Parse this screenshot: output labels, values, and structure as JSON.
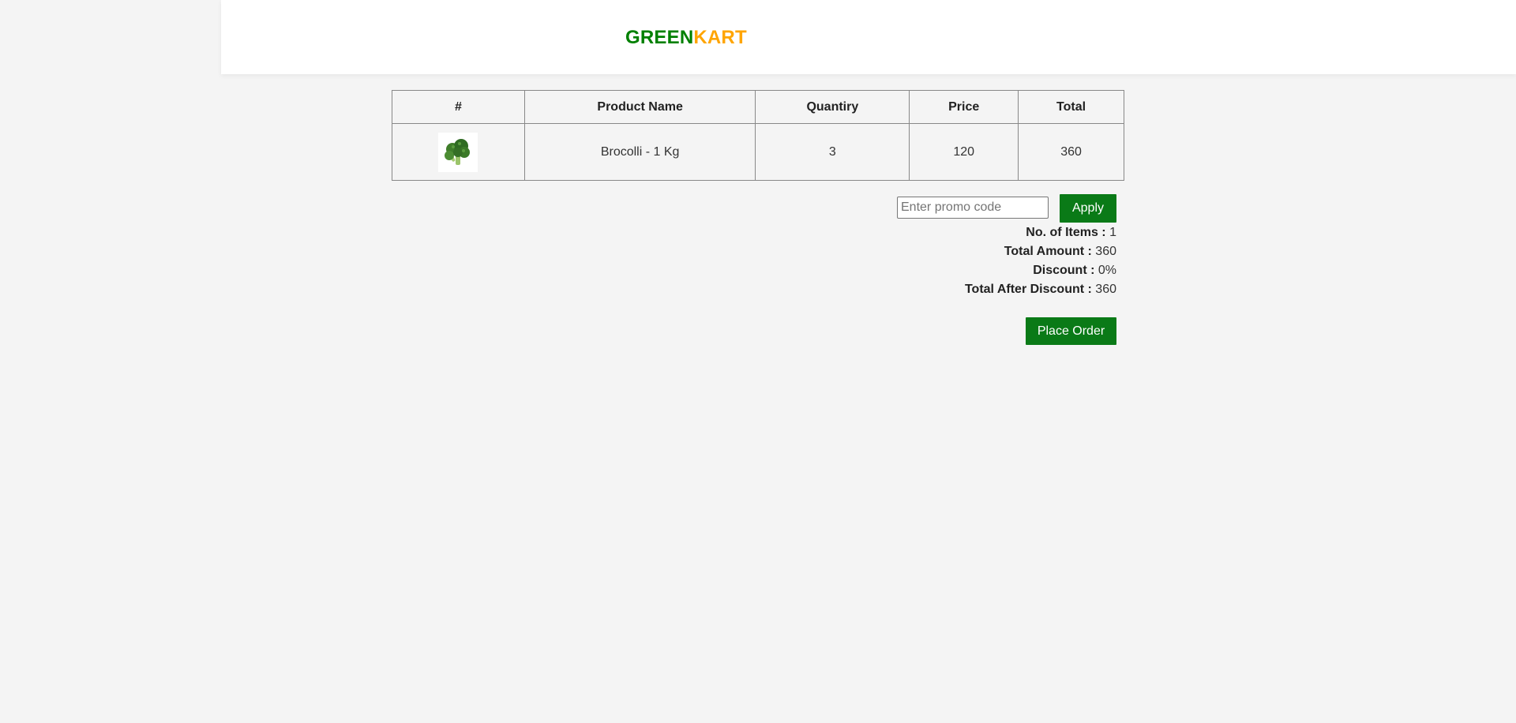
{
  "header": {
    "logo_part1": "GREEN",
    "logo_part2": "KART"
  },
  "table": {
    "columns": [
      "#",
      "Product Name",
      "Quantiry",
      "Price",
      "Total"
    ],
    "rows": [
      {
        "image_icon": "broccoli-icon",
        "product_name": "Brocolli - 1 Kg",
        "quantity": "3",
        "price": "120",
        "total": "360"
      }
    ]
  },
  "promo": {
    "placeholder": "Enter promo code",
    "value": "",
    "apply_label": "Apply"
  },
  "summary": {
    "items_label": "No. of Items :",
    "items_value": "1",
    "amount_label": "Total Amount :",
    "amount_value": "360",
    "discount_label": "Discount :",
    "discount_value": "0%",
    "after_discount_label": "Total After Discount :",
    "after_discount_value": "360"
  },
  "actions": {
    "place_order_label": "Place Order"
  },
  "colors": {
    "brand_green": "#008000",
    "brand_orange": "#ffa500",
    "button_green": "#0a7a17",
    "background": "#f4f4f4"
  }
}
